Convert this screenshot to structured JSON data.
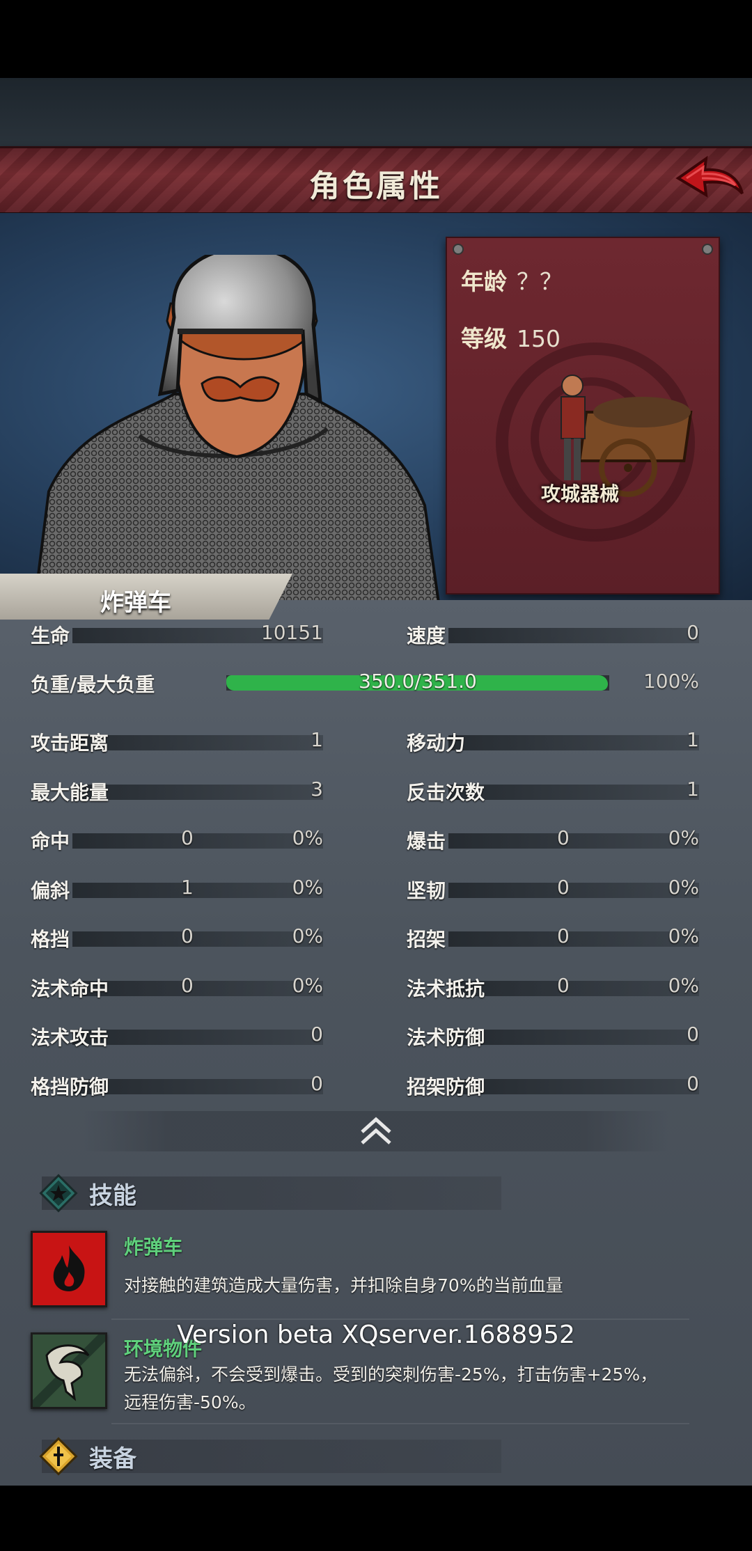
{
  "header": {
    "title": "角色属性",
    "back_icon": "back-arrow-icon"
  },
  "unit": {
    "name": "炸弹车",
    "age_label": "年龄",
    "age_value": "？？",
    "level_label": "等级",
    "level_value": "150",
    "class_name": "攻城器械"
  },
  "stats": {
    "hp": {
      "label": "生命",
      "value": "10151"
    },
    "speed": {
      "label": "速度",
      "value": "0"
    },
    "load": {
      "label": "负重/最大负重",
      "value": "350.0/351.0",
      "percent": "100%",
      "fraction": 0.997,
      "color": "#2fb34a"
    },
    "grid": [
      {
        "label": "攻击距离",
        "v2": "1"
      },
      {
        "label": "移动力",
        "v2": "1"
      },
      {
        "label": "最大能量",
        "v2": "3"
      },
      {
        "label": "反击次数",
        "v2": "1"
      },
      {
        "label": "命中",
        "v1": "0",
        "v2": "0%"
      },
      {
        "label": "爆击",
        "v1": "0",
        "v2": "0%"
      },
      {
        "label": "偏斜",
        "v1": "1",
        "v2": "0%"
      },
      {
        "label": "坚韧",
        "v1": "0",
        "v2": "0%"
      },
      {
        "label": "格挡",
        "v1": "0",
        "v2": "0%"
      },
      {
        "label": "招架",
        "v1": "0",
        "v2": "0%"
      },
      {
        "label": "法术命中",
        "v1": "0",
        "v2": "0%"
      },
      {
        "label": "法术抵抗",
        "v1": "0",
        "v2": "0%"
      },
      {
        "label": "法术攻击",
        "v2": "0"
      },
      {
        "label": "法术防御",
        "v2": "0"
      },
      {
        "label": "格挡防御",
        "v2": "0"
      },
      {
        "label": "招架防御",
        "v2": "0"
      }
    ]
  },
  "collapse_icon": "double-chevron-up-icon",
  "skills_section": {
    "title": "技能",
    "skills": [
      {
        "name": "炸弹车",
        "desc": "对接触的建筑造成大量伤害，并扣除自身70%的当前血量",
        "icon": "fire-icon"
      },
      {
        "name": "环境物件",
        "desc_line1": "无法偏斜，不会受到爆击。受到的突刺伤害-25%，打击伤害+25%，",
        "desc_line2": "远程伤害-50%。",
        "icon": "goat-skull-icon"
      }
    ]
  },
  "equipment_section": {
    "title": "装备"
  },
  "version": "Version beta XQserver.1688952"
}
